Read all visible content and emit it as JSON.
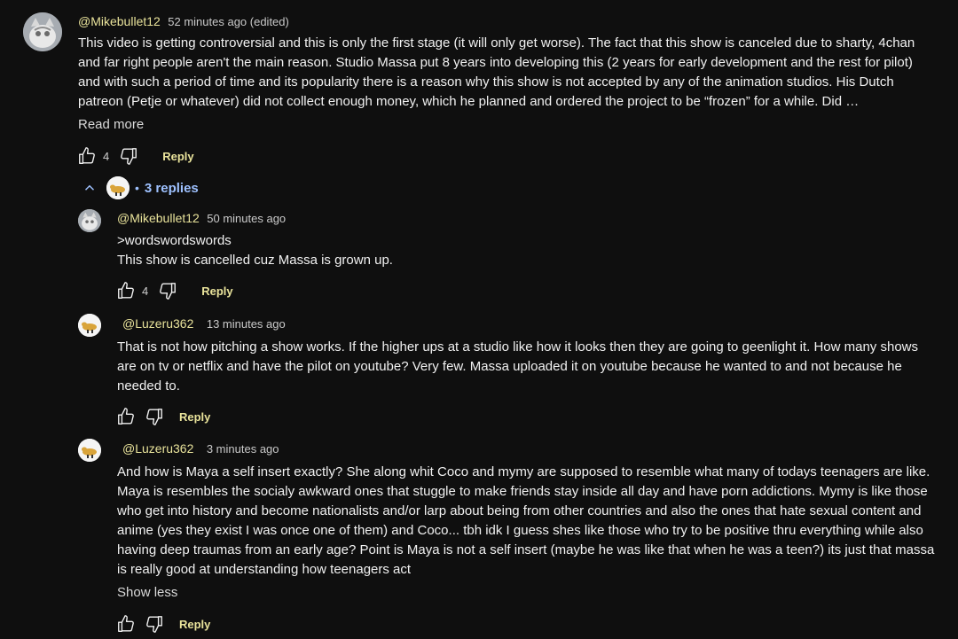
{
  "main_comment": {
    "handle": "@Mikebullet12",
    "time": "52 minutes ago (edited)",
    "text": "This video is getting controversial and this is only the first stage (it will only get worse). The fact that this show is canceled due to sharty, 4chan and far right people aren't the main reason. Studio Massa put 8 years into developing this (2 years for early development and the rest for pilot) and with such a period of time and its popularity there is a reason why this show is not accepted by any of the animation studios. His Dutch patreon (Petje or whatever) did not collect enough money, which he planned and ordered the project to be “frozen” for a while. Did …",
    "read_more": "Read more",
    "likes": "4",
    "reply_label": "Reply"
  },
  "replies_toggle": {
    "separator": "•",
    "label": "3 replies"
  },
  "replies": [
    {
      "handle": "@Mikebullet12",
      "time": "50 minutes ago",
      "lines": [
        ">wordswordswords",
        "This show is cancelled cuz Massa is grown up."
      ],
      "likes": "4",
      "reply_label": "Reply"
    },
    {
      "handle": "@Luzeru362",
      "time": "13 minutes ago",
      "text": "That is not how pitching a show works. If the higher ups at a studio like how it looks then they are going to geenlight it. How many shows are on tv or netflix and have the pilot on youtube? Very few. Massa uploaded it on youtube because he wanted to and not because he needed to.",
      "likes": "",
      "reply_label": "Reply"
    },
    {
      "handle": "@Luzeru362",
      "time": "3 minutes ago",
      "text": "And how is Maya a self insert exactly? She along whit Coco and mymy are supposed to resemble what many of todays teenagers are like. Maya is resembles the socialy awkward ones that stuggle to make friends stay inside all day and have porn addictions. Mymy is like those who get into history and become nationalists and/or larp about being from other countries and also the ones that hate sexual content and anime (yes they exist I was once one of them) and Coco... tbh idk I guess shes like those who try to be positive thru everything while also having deep traumas from an early age? Point is Maya is not a self insert (maybe he was like that when he was a teen?) its just that massa is really good at understanding how teenagers act",
      "show_less": "Show less",
      "likes": "",
      "reply_label": "Reply"
    }
  ],
  "colors": {
    "background": "#0f0f0f",
    "handle": "#e9e39b",
    "link_blue": "#9ec1ff",
    "text": "#f1f1f1"
  }
}
